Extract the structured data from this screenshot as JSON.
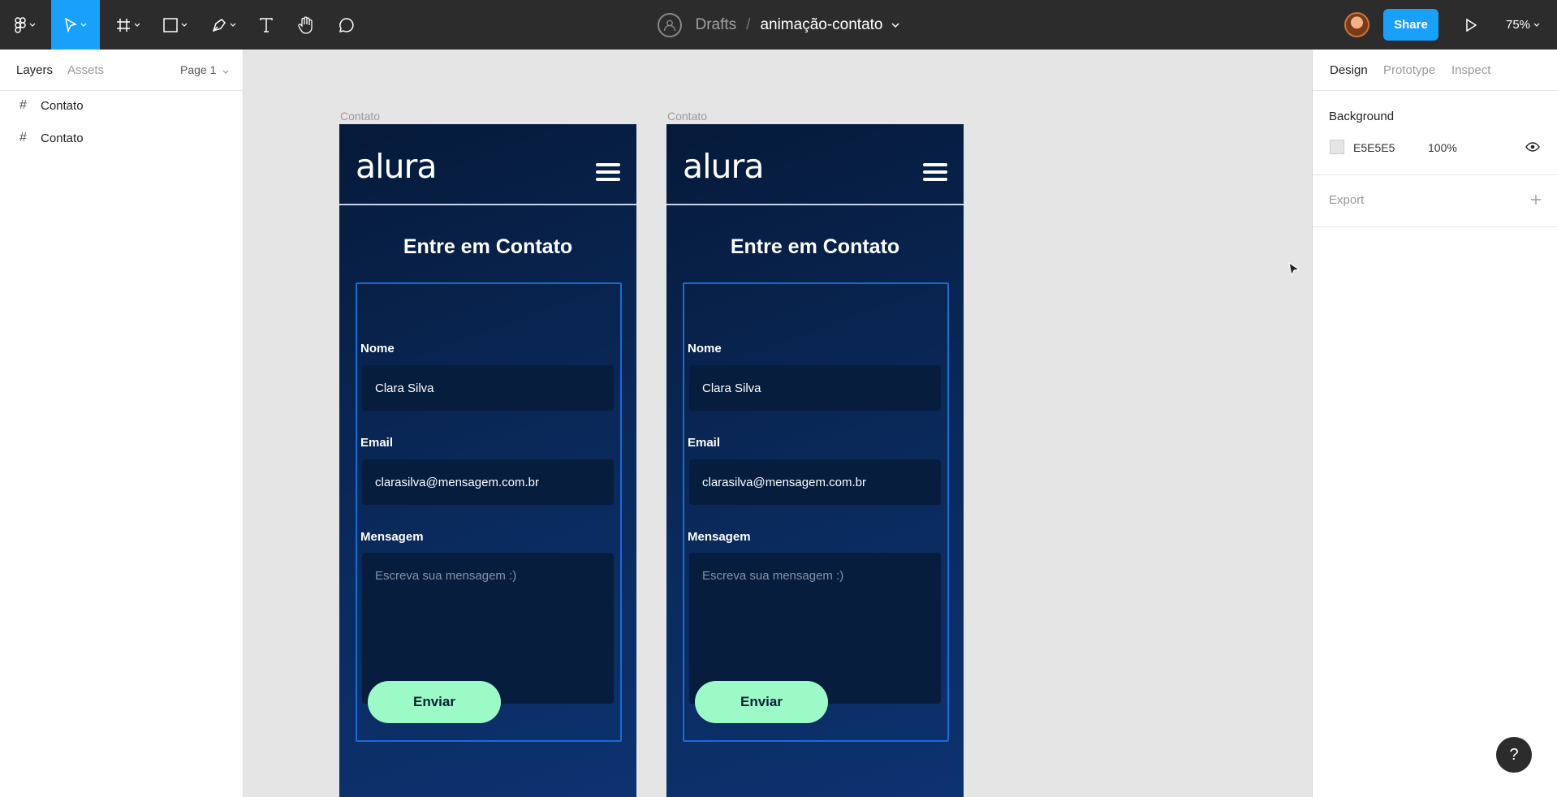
{
  "toolbar": {
    "tools": [
      {
        "name": "main-menu",
        "icon": "figma-logo-icon"
      },
      {
        "name": "move",
        "icon": "move-cursor-icon",
        "active": true
      },
      {
        "name": "frame",
        "icon": "frame-hash-icon"
      },
      {
        "name": "shape",
        "icon": "rectangle-icon"
      },
      {
        "name": "pen",
        "icon": "pen-icon"
      },
      {
        "name": "text",
        "icon": "text-icon"
      },
      {
        "name": "hand",
        "icon": "hand-icon"
      },
      {
        "name": "comment",
        "icon": "comment-icon"
      }
    ],
    "breadcrumb_root": "Drafts",
    "separator": "/",
    "file_name": "animação-contato",
    "share_label": "Share",
    "zoom_label": "75%",
    "accent_color": "#18a0fb"
  },
  "left_panel": {
    "tabs": [
      "Layers",
      "Assets"
    ],
    "page_selector": "Page 1",
    "layers": [
      {
        "label": "Contato"
      },
      {
        "label": "Contato"
      }
    ]
  },
  "right_panel": {
    "tabs": [
      "Design",
      "Prototype",
      "Inspect"
    ],
    "background_title": "Background",
    "background_hex": "E5E5E5",
    "background_opacity": "100%",
    "export_title": "Export"
  },
  "canvas": {
    "frames": [
      {
        "label": "Contato",
        "logo": "alura",
        "heading": "Entre em Contato",
        "name_label": "Nome",
        "name_value": "Clara Silva",
        "email_label": "Email",
        "email_value": "clarasilva@mensagem.com.br",
        "message_label": "Mensagem",
        "message_placeholder": "Escreva sua mensagem :)",
        "send_label": "Enviar"
      },
      {
        "label": "Contato",
        "logo": "alura",
        "heading": "Entre em Contato",
        "name_label": "Nome",
        "name_value": "Clara Silva",
        "email_label": "Email",
        "email_value": "clarasilva@mensagem.com.br",
        "message_label": "Mensagem",
        "message_placeholder": "Escreva sua mensagem :)",
        "send_label": "Enviar"
      }
    ],
    "button_color": "#9cfac6"
  },
  "help_label": "?"
}
